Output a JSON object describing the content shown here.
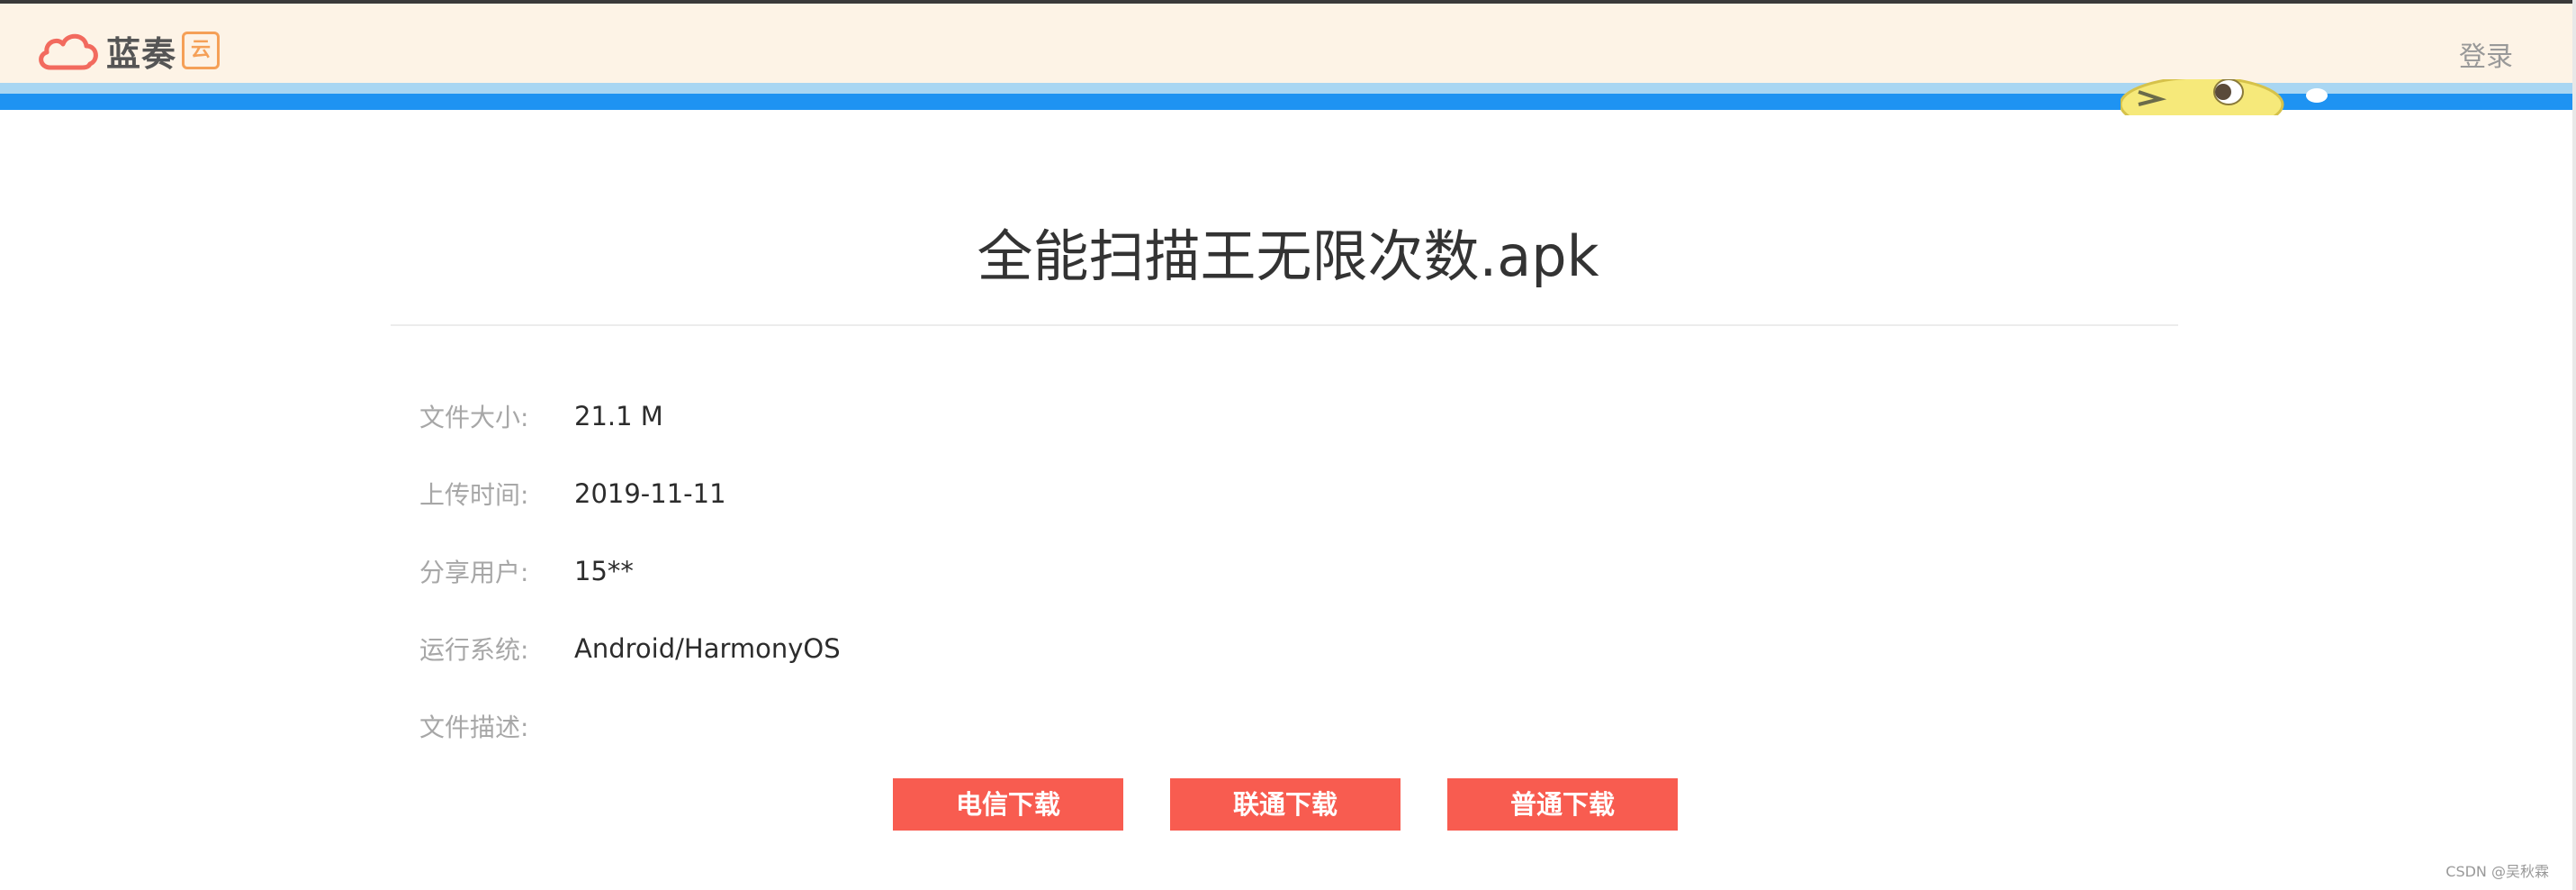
{
  "header": {
    "logo_text": "蓝奏",
    "logo_badge": "云",
    "login_label": "登录"
  },
  "file": {
    "title": "全能扫描王无限次数.apk",
    "details": [
      {
        "label": "文件大小:",
        "value": "21.1 M"
      },
      {
        "label": "上传时间:",
        "value": "2019-11-11"
      },
      {
        "label": "分享用户:",
        "value": "15**"
      },
      {
        "label": "运行系统:",
        "value": "Android/HarmonyOS"
      },
      {
        "label": "文件描述:",
        "value": ""
      }
    ]
  },
  "downloads": {
    "telecom_label": "电信下载",
    "unicom_label": "联通下载",
    "normal_label": "普通下载"
  },
  "watermark": "CSDN @吴秋霖",
  "colors": {
    "header_bg": "#fdf3e6",
    "accent_blue": "#1e93f2",
    "button_red": "#f85c50",
    "logo_orange": "#f5a057"
  },
  "icons": {
    "logo": "cloud-icon",
    "mascot": "mascot-icon"
  }
}
